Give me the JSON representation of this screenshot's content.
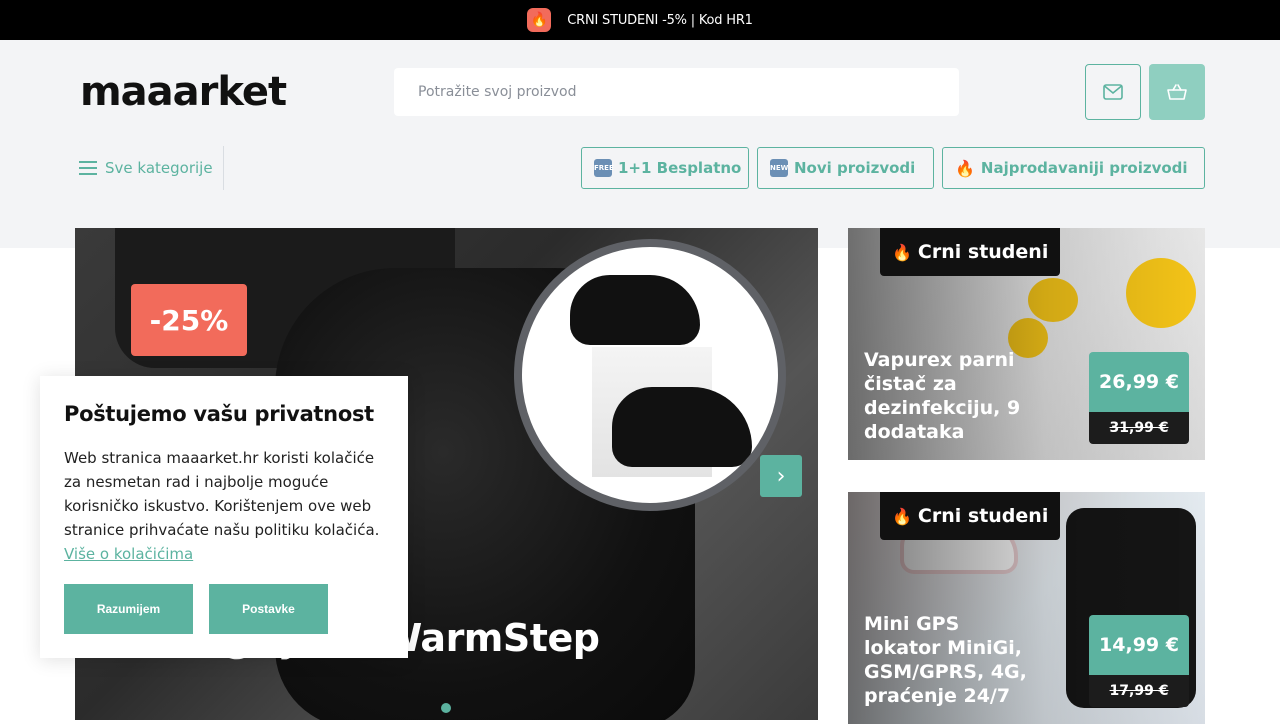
{
  "promo": {
    "icon": "fire-icon",
    "text": "CRNI STUDENI -5% | Kod HR1"
  },
  "header": {
    "logo": "maaarket",
    "search_placeholder": "Potražite svoj proizvod",
    "mail_icon": "mail-icon",
    "cart_icon": "basket-icon",
    "categories_label": "Sve kategorije",
    "nav": [
      {
        "badge": "FREE",
        "label": "1+1 Besplatno"
      },
      {
        "badge": "NEW",
        "label": "Novi proizvodi"
      },
      {
        "badge": "fire",
        "label": "Najprodavaniji proizvodi"
      }
    ]
  },
  "hero": {
    "discount": "-25%",
    "title": "gr  jače WarmStep",
    "next_icon": "chevron-right-icon"
  },
  "cards": [
    {
      "tag": "Crni studeni",
      "name": "Vapurex parni čistač za dezinfekciju, 9 dodataka",
      "price": "26,99 €",
      "old_price": "31,99 €"
    },
    {
      "tag": "Crni studeni",
      "name": "Mini GPS lokator MiniGi, GSM/GPRS, 4G, praćenje 24/7",
      "price": "14,99 €",
      "old_price": "17,99 €"
    }
  ],
  "cookie": {
    "title": "Poštujemo vašu privatnost",
    "text": "Web stranica maaarket.hr koristi kolačiće za nesmetan rad i najbolje moguće korisničko iskustvo. Korištenjem ove web stranice prihvaćate našu politiku kolačića.",
    "link": "Više o kolačićima",
    "accept": "Razumijem",
    "settings": "Postavke"
  },
  "colors": {
    "accent": "#5cb3a0",
    "promo_bg": "#000000",
    "discount": "#f26b5b"
  }
}
